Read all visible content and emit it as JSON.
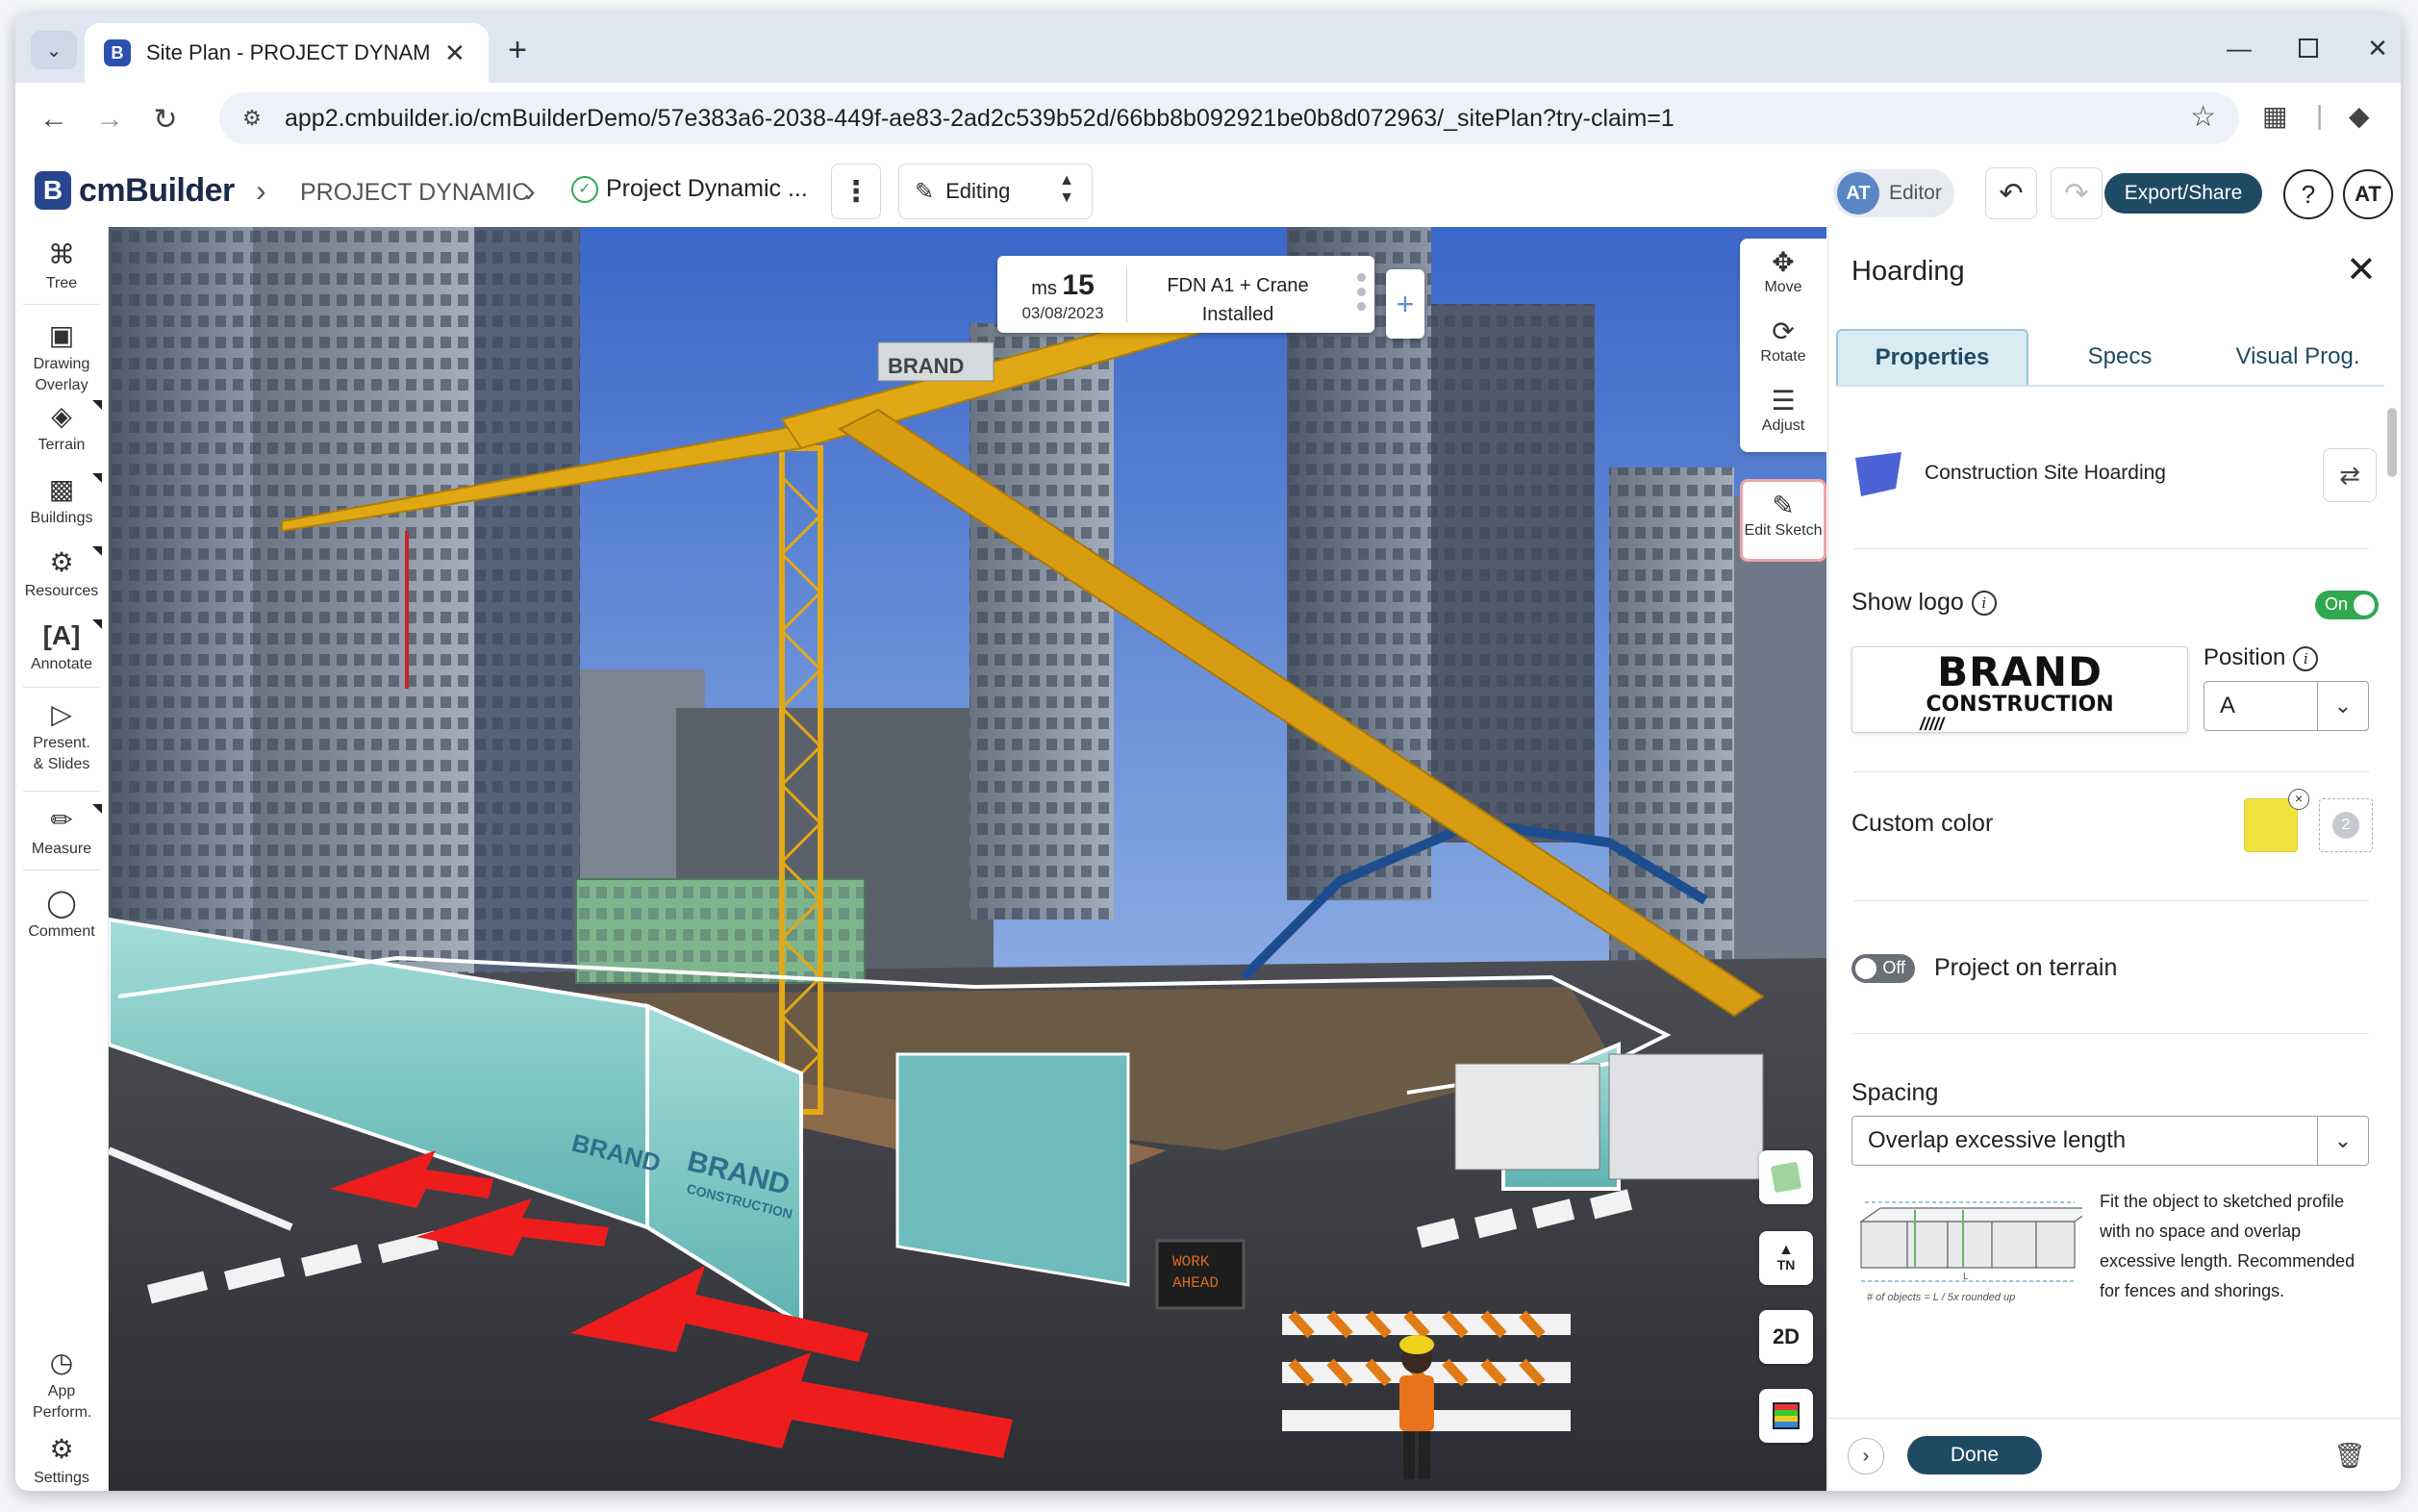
{
  "browser": {
    "tab_title": "Site Plan - PROJECT DYNAMIC |",
    "url": "app2.cmbuilder.io/cmBuilderDemo/57e383a6-2038-449f-ae83-2ad2c539b52d/66bb8b092921be0b8d072963/_sitePlan?try-claim=1"
  },
  "header": {
    "logo_text": "cmBuilder",
    "breadcrumb_project": "PROJECT DYNAMIC",
    "breadcrumb_plan": "Project Dynamic ...",
    "mode": "Editing",
    "role_initials": "AT",
    "role_label": "Editor",
    "export_label": "Export/Share",
    "help_label": "?",
    "user_initials": "AT"
  },
  "left_tools": [
    {
      "icon": "tree-icon",
      "label": "Tree"
    },
    {
      "icon": "drawing-overlay-icon",
      "label": "Drawing Overlay"
    },
    {
      "icon": "terrain-icon",
      "label": "Terrain"
    },
    {
      "icon": "buildings-icon",
      "label": "Buildings"
    },
    {
      "icon": "resources-icon",
      "label": "Resources"
    },
    {
      "icon": "annotate-icon",
      "label": "Annotate"
    },
    {
      "icon": "present-slides-icon",
      "label": "Present. & Slides"
    },
    {
      "icon": "measure-icon",
      "label": "Measure"
    },
    {
      "icon": "comment-icon",
      "label": "Comment"
    },
    {
      "icon": "app-performance-icon",
      "label": "App Perform."
    },
    {
      "icon": "settings-icon",
      "label": "Settings"
    }
  ],
  "milestone": {
    "prefix": "ms",
    "number": "15",
    "date": "03/08/2023",
    "name_line1": "FDN A1 + Crane",
    "name_line2": "Installed"
  },
  "view_tools": {
    "move": "Move",
    "rotate": "Rotate",
    "adjust": "Adjust",
    "edit_sketch": "Edit Sketch",
    "north_label": "TN",
    "view_mode": "2D"
  },
  "scene_text": {
    "crane_brand": "BRAND",
    "hoarding_brand": "BRAND",
    "hoarding_sub": "CONSTRUCTION",
    "sign_line1": "WORK",
    "sign_line2": "AHEAD"
  },
  "panel": {
    "title": "Hoarding",
    "tabs": [
      "Properties",
      "Specs",
      "Visual Prog."
    ],
    "active_tab": "Properties",
    "object_name": "Construction Site Hoarding",
    "show_logo_label": "Show logo",
    "show_logo_state": "On",
    "logo_brand": "BRAND",
    "logo_sub": "CONSTRUCTION",
    "logo_marks": "/////",
    "position_label": "Position",
    "position_value": "A",
    "custom_color_label": "Custom color",
    "custom_color": "#f1e23c",
    "project_on_terrain_label": "Project on terrain",
    "project_on_terrain_state": "Off",
    "spacing_label": "Spacing",
    "spacing_value": "Overlap excessive length",
    "spacing_description": "Fit the object to sketched profile with no space and overlap excessive length. Recommended for fences and shorings.",
    "diagram_formula": "# of objects = L / 5x rounded up",
    "diagram_l": "L",
    "done_label": "Done"
  },
  "colors": {
    "accent": "#1f4a63",
    "toggle_on": "#2fa84f",
    "toggle_off": "#6a6f76",
    "tab_active_bg": "#d9ebf3"
  }
}
